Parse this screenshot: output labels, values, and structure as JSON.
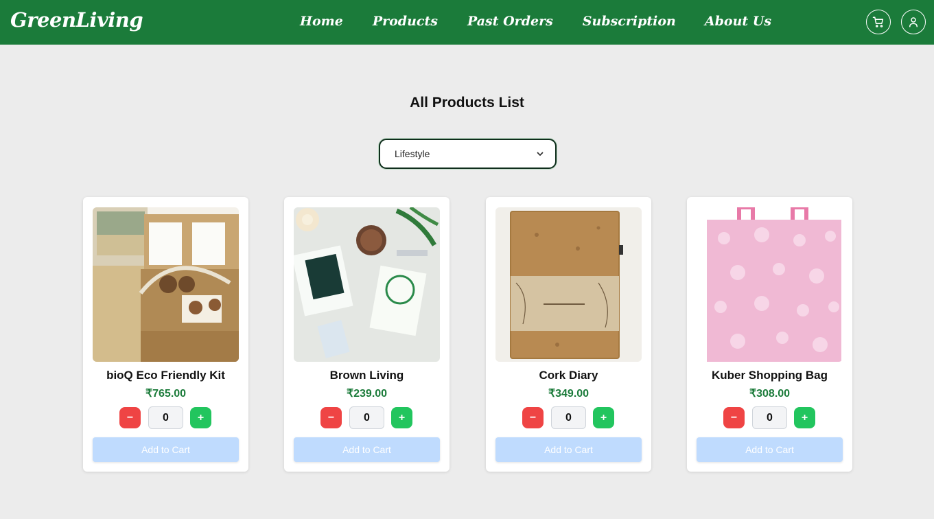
{
  "brand": "GreenLiving",
  "nav": [
    "Home",
    "Products",
    "Past Orders",
    "Subscription",
    "About Us"
  ],
  "icons": {
    "cart": "cart-icon",
    "user": "user-icon",
    "chevron": "chevron-down-icon"
  },
  "page_title": "All Products List",
  "category_select": {
    "value": "Lifestyle"
  },
  "products": [
    {
      "name": "bioQ Eco Friendly Kit",
      "price": "₹765.00",
      "qty": "0",
      "minus": "−",
      "plus": "+",
      "add_label": "Add to Cart"
    },
    {
      "name": "Brown Living",
      "price": "₹239.00",
      "qty": "0",
      "minus": "−",
      "plus": "+",
      "add_label": "Add to Cart"
    },
    {
      "name": "Cork Diary",
      "price": "₹349.00",
      "qty": "0",
      "minus": "−",
      "plus": "+",
      "add_label": "Add to Cart"
    },
    {
      "name": "Kuber Shopping Bag",
      "price": "₹308.00",
      "qty": "0",
      "minus": "−",
      "plus": "+",
      "add_label": "Add to Cart"
    }
  ],
  "colors": {
    "header": "#1b7b3a",
    "price": "#1b7b3a",
    "minus": "#ef4444",
    "plus": "#22c55e",
    "add_button": "#bfdbfe",
    "background": "#ececec"
  }
}
